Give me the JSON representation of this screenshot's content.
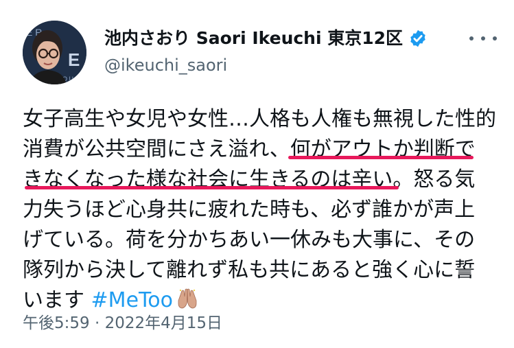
{
  "user": {
    "display_name": "池内さおり Saori Ikeuchi 東京12区",
    "handle": "@ikeuchi_saori",
    "verified_icon": "verified-badge-icon"
  },
  "tweet": {
    "lines": [
      "女子高生や女児や女性…人格も人権も無視した性的",
      "消費が公共空間にさえ溢れ、何がアウトか判断で",
      "きなくなった様な社会に生きるのは辛い。怒る気",
      "力失うほど心身共に疲れた時も、必ず誰かが声上",
      "げている。荷を分かちあい一休みも大事に、その",
      "隊列から決して離れず私も共にあると強く心に誓",
      "います"
    ],
    "hashtag": "#MeToo",
    "emoji": "raised-hands-emoji",
    "underline_color": "#e8195b"
  },
  "timestamp": "午後5:59 · 2022年4月15日",
  "colors": {
    "text": "#0f1419",
    "secondary": "#536471",
    "link": "#1d9bf0",
    "verified": "#1d9bf0"
  }
}
